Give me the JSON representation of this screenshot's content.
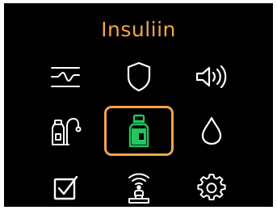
{
  "screen": {
    "title": "Insuliin",
    "accent_color": "#f2a54a",
    "selected_color": "#22c55e",
    "icon_color": "#ffffff"
  },
  "menu": {
    "items": [
      {
        "icon": "trend-graph-icon",
        "selected": false
      },
      {
        "icon": "shield-icon",
        "selected": false
      },
      {
        "icon": "speaker-volume-icon",
        "selected": false
      },
      {
        "icon": "vial-tubing-icon",
        "selected": false
      },
      {
        "icon": "insulin-vial-icon",
        "selected": true
      },
      {
        "icon": "drop-icon",
        "selected": false
      },
      {
        "icon": "checkbox-icon",
        "selected": false
      },
      {
        "icon": "wireless-sensor-icon",
        "selected": false
      },
      {
        "icon": "gear-icon",
        "selected": false
      }
    ]
  }
}
